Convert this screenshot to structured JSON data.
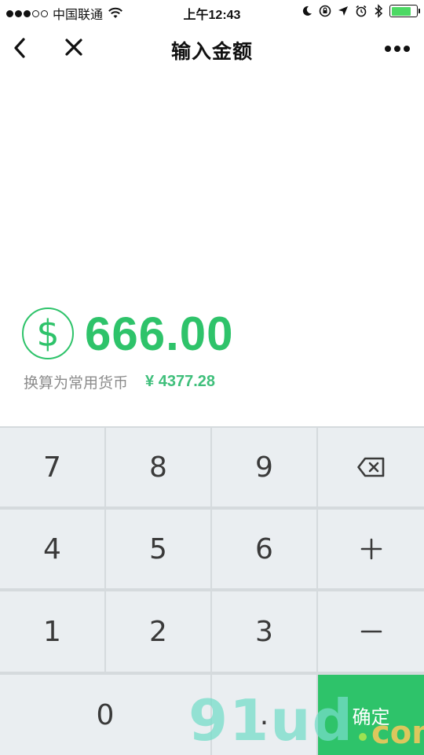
{
  "status_bar": {
    "carrier": "中国联通",
    "time": "上午12:43",
    "battery_level": 0.8
  },
  "nav": {
    "title": "输入金额",
    "icons": [
      "back-chevron-icon",
      "close-icon",
      "more-icon"
    ]
  },
  "amount": {
    "currency_symbol": "$",
    "value": "666.00",
    "conversion_label": "换算为常用货币",
    "conversion_value": "¥ 4377.28"
  },
  "keypad": {
    "keys": [
      "7",
      "8",
      "9",
      "4",
      "5",
      "6",
      "1",
      "2",
      "3",
      "0",
      "."
    ],
    "backspace_icon": "backspace-icon",
    "plus_icon": "plus-icon",
    "minus_icon": "minus-icon",
    "confirm_label": "确定"
  },
  "watermark": {
    "main": "91ud",
    "suffix": "com"
  },
  "colors": {
    "accent": "#2ec36a",
    "key_bg": "#eaeef1",
    "key_gap": "#d5dadd"
  }
}
